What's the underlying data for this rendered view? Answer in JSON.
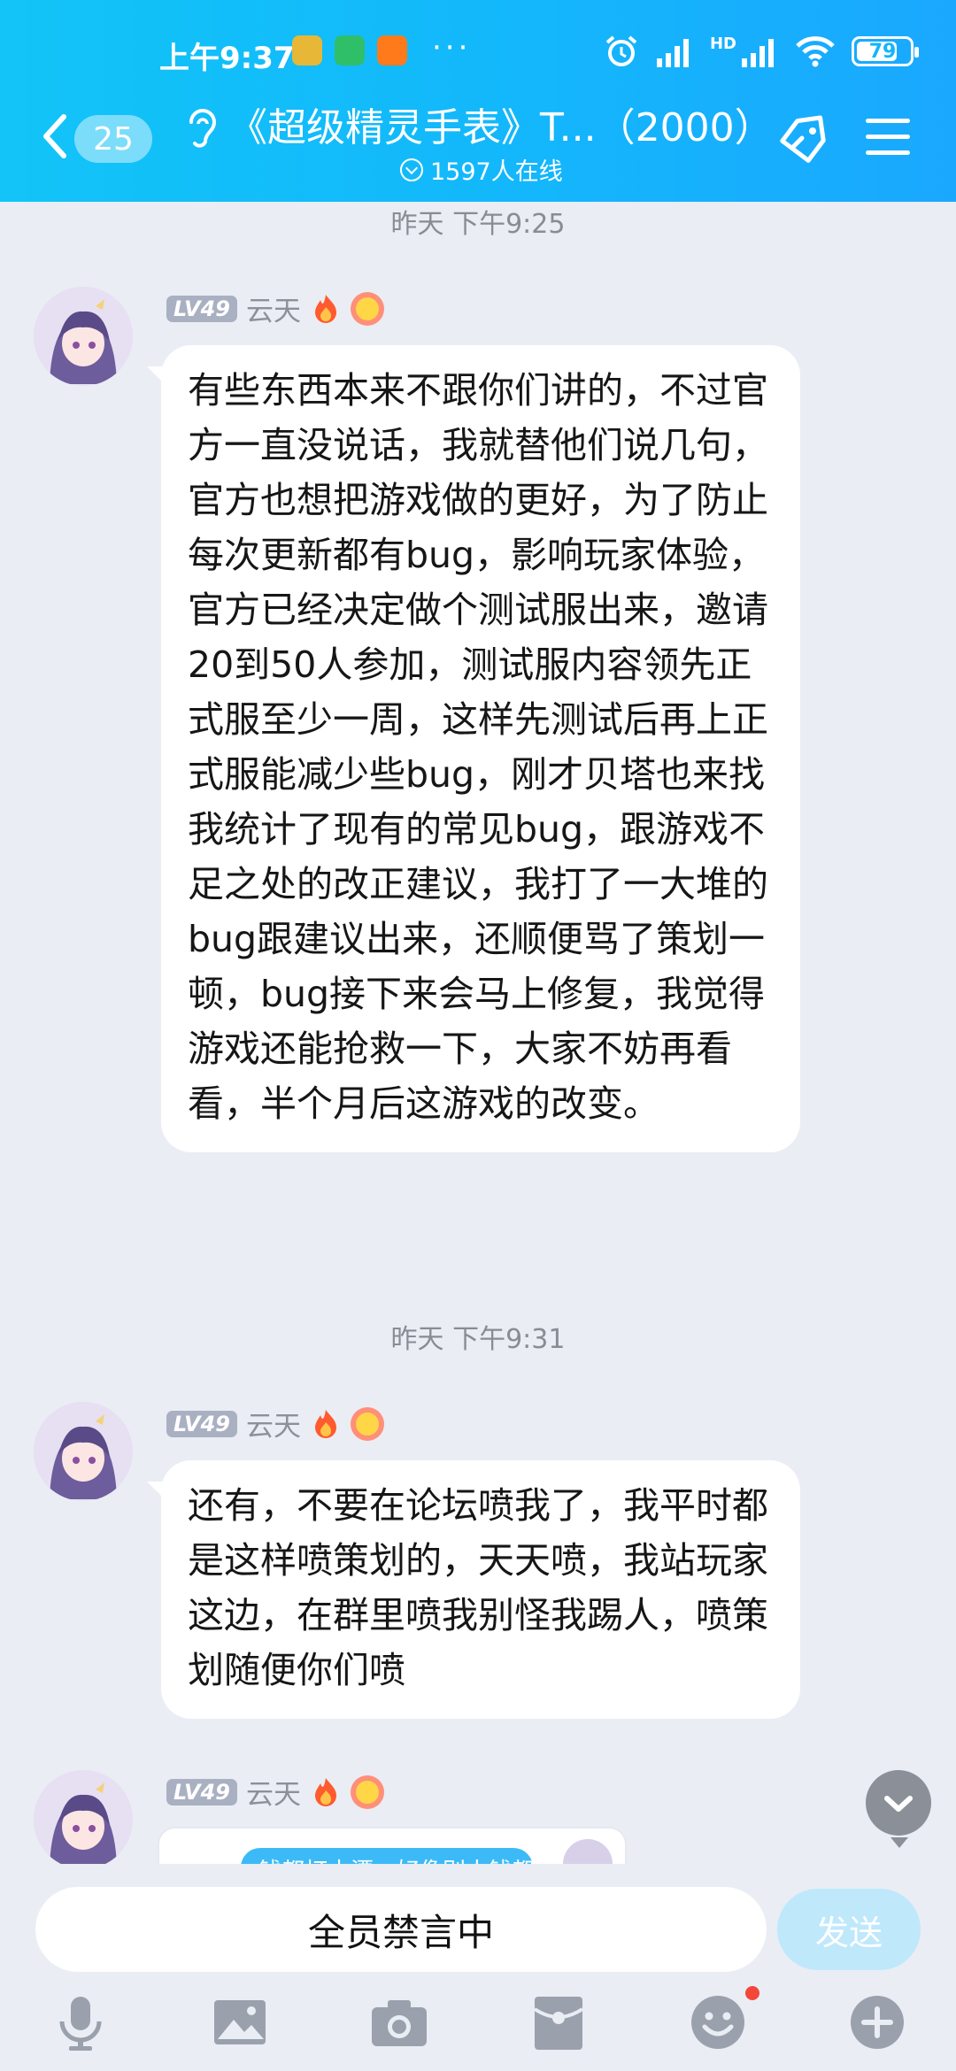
{
  "status_bar": {
    "time": "上午9:37",
    "dots": "···",
    "network": "HD",
    "battery": "79"
  },
  "header": {
    "unread_count": "25",
    "title": "《超级精灵手表》T...（2000）",
    "online_count": "1597人在线"
  },
  "messages": [
    {
      "timestamp": "昨天 下午9:25",
      "level": "LV49",
      "sender": "云天",
      "text": "有些东西本来不跟你们讲的，不过官方一直没说话，我就替他们说几句，官方也想把游戏做的更好，为了防止每次更新都有bug，影响玩家体验，官方已经决定做个测试服出来，邀请20到50人参加，测试服内容领先正式服至少一周，这样先测试后再上正式服能减少些bug，刚才贝塔也来找我统计了现有的常见bug，跟游戏不足之处的改正建议，我打了一大堆的bug跟建议出来，还顺便骂了策划一顿，bug接下来会马上修复，我觉得游戏还能抢救一下，大家不妨再看看，半个月后这游戏的改变。"
    },
    {
      "timestamp": "昨天 下午9:31",
      "level": "LV49",
      "sender": "云天",
      "text": "还有，不要在论坛喷我了，我平时都是这样喷策划的，天天喷，我站玩家这边，在群里喷我别怪我踢人，喷策划随便你们喷"
    },
    {
      "level": "LV49",
      "sender": "云天",
      "preview_text": "钱都打水漂，好像别人钱都"
    }
  ],
  "input": {
    "muted_text": "全员禁言中",
    "send_label": "发送"
  },
  "toolbar_icons": [
    "mic-icon",
    "image-icon",
    "camera-icon",
    "red-packet-icon",
    "emoji-icon",
    "plus-icon"
  ],
  "colors": {
    "header_start": "#12c4f7",
    "header_end": "#1aa8ff",
    "background": "#eaedf4",
    "send_disabled": "#bfe8fb"
  }
}
